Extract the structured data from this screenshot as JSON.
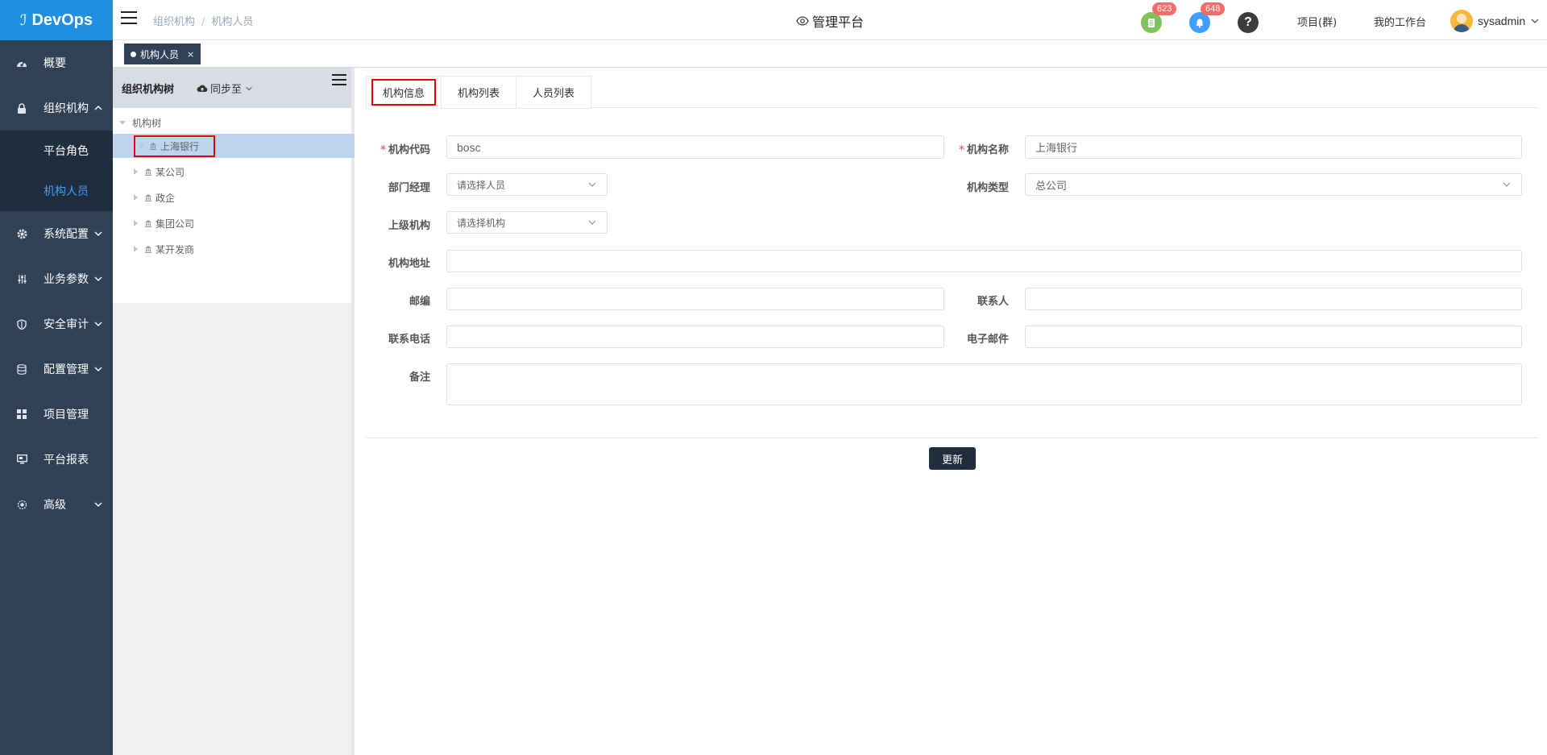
{
  "app": {
    "logo_text": "DevOps",
    "logo_icon": "devops-logo-icon"
  },
  "sidebar": {
    "items": [
      {
        "label": "概要",
        "icon": "dashboard-icon"
      },
      {
        "label": "组织机构",
        "icon": "lock-icon",
        "expanded": true,
        "children": [
          {
            "label": "平台角色"
          },
          {
            "label": "机构人员",
            "active": true
          }
        ]
      },
      {
        "label": "系统配置",
        "icon": "gear-icon"
      },
      {
        "label": "业务参数",
        "icon": "sliders-icon"
      },
      {
        "label": "安全审计",
        "icon": "shield-icon"
      },
      {
        "label": "配置管理",
        "icon": "database-icon"
      },
      {
        "label": "项目管理",
        "icon": "grid-icon"
      },
      {
        "label": "平台报表",
        "icon": "monitor-icon"
      },
      {
        "label": "高级",
        "icon": "advanced-icon"
      }
    ]
  },
  "header": {
    "breadcrumb": [
      "组织机构",
      "机构人员"
    ],
    "center_title": "管理平台",
    "badges": [
      {
        "icon": "document-icon",
        "count": "623",
        "color": "#67c23a"
      },
      {
        "icon": "bell-icon",
        "count": "648",
        "color": "#409eff"
      }
    ],
    "help_icon": "help-icon",
    "links": [
      "项目(群)",
      "我的工作台"
    ],
    "username": "sysadmin"
  },
  "tagsview": {
    "tags": [
      {
        "label": "机构人员",
        "active": true
      }
    ]
  },
  "tree": {
    "title": "组织机构树",
    "sync_label": "同步至",
    "root_label": "机构树",
    "nodes": [
      {
        "label": "上海银行",
        "selected": true
      },
      {
        "label": "某公司"
      },
      {
        "label": "政企"
      },
      {
        "label": "集团公司"
      },
      {
        "label": "某开发商"
      }
    ]
  },
  "tabs": [
    "机构信息",
    "机构列表",
    "人员列表"
  ],
  "form": {
    "org_code": {
      "label": "机构代码",
      "value": "bosc",
      "required": true
    },
    "org_name": {
      "label": "机构名称",
      "value": "上海银行",
      "required": true
    },
    "dept_manager": {
      "label": "部门经理",
      "placeholder": "请选择人员"
    },
    "org_type": {
      "label": "机构类型",
      "value": "总公司"
    },
    "parent_org": {
      "label": "上级机构",
      "placeholder": "请选择机构"
    },
    "address": {
      "label": "机构地址",
      "value": ""
    },
    "postcode": {
      "label": "邮编",
      "value": ""
    },
    "contact": {
      "label": "联系人",
      "value": ""
    },
    "phone": {
      "label": "联系电话",
      "value": ""
    },
    "email": {
      "label": "电子邮件",
      "value": ""
    },
    "remark": {
      "label": "备注",
      "value": ""
    },
    "submit_label": "更新"
  }
}
